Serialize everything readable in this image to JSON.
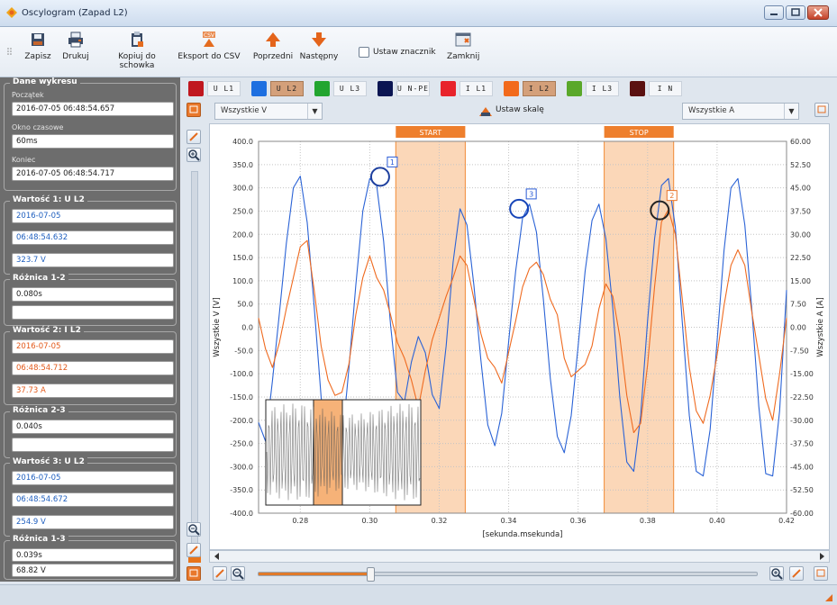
{
  "window": {
    "title": "Oscylogram (Zapad L2)"
  },
  "toolbar": {
    "save": "Zapisz",
    "print": "Drukuj",
    "copy": "Kopiuj do schowka",
    "export_csv": "Eksport do CSV",
    "previous": "Poprzedni",
    "next": "Następny",
    "set_marker": "Ustaw znacznik",
    "set_marker_checked": false,
    "close": "Zamknij",
    "csv_badge": "CSV"
  },
  "panel": {
    "chart_data_group": {
      "title": "Dane wykresu",
      "start_label": "Początek",
      "start_value": "2016-07-05 06:48:54.657",
      "window_label": "Okno czasowe",
      "window_value": "60ms",
      "end_label": "Koniec",
      "end_value": "2016-07-05 06:48:54.717"
    },
    "value1": {
      "title": "Wartość 1: U L2",
      "date": "2016-07-05",
      "time": "06:48:54.632",
      "value": "323.7 V"
    },
    "diff12": {
      "title": "Różnica 1-2",
      "value": "0.080s",
      "value2": ""
    },
    "value2": {
      "title": "Wartość 2: I L2",
      "date": "2016-07-05",
      "time": "06:48:54.712",
      "value": "37.73 A"
    },
    "diff23": {
      "title": "Różnica 2-3",
      "value": "0.040s",
      "value2": ""
    },
    "value3": {
      "title": "Wartość 3: U L2",
      "date": "2016-07-05",
      "time": "06:48:54.672",
      "value": "254.9 V"
    },
    "diff13": {
      "title": "Różnica 1-3",
      "value": "0.039s",
      "value2": "68.82 V"
    }
  },
  "channels": [
    {
      "name": "U L1",
      "color": "#c0171f",
      "selected": false
    },
    {
      "name": "U L2",
      "color": "#1d6fe0",
      "selected": true
    },
    {
      "name": "U L3",
      "color": "#22a52f",
      "selected": false
    },
    {
      "name": "U N-PE",
      "color": "#0b1552",
      "selected": false
    },
    {
      "name": "I L1",
      "color": "#e8232b",
      "selected": false
    },
    {
      "name": "I L2",
      "color": "#f26a1c",
      "selected": true
    },
    {
      "name": "I L3",
      "color": "#5aa82a",
      "selected": false
    },
    {
      "name": "I N",
      "color": "#5b1111",
      "selected": false
    }
  ],
  "selectors": {
    "left": "Wszystkie V",
    "right": "Wszystkie A",
    "set_scale": "Ustaw skalę"
  },
  "chart_data": {
    "type": "line",
    "xlabel": "[sekunda.msekunda]",
    "ylabel_left": "Wszystkie V [V]",
    "ylabel_right": "Wszystkie A [A]",
    "xlim": [
      0.268,
      0.42
    ],
    "ylim_left": [
      -400,
      400
    ],
    "ylim_right": [
      -60,
      60
    ],
    "x_ticks": [
      "0.28",
      "0.30",
      "0.32",
      "0.34",
      "0.36",
      "0.38",
      "0.40",
      "0.42"
    ],
    "y_ticks_left": [
      "400.0",
      "350.0",
      "300.0",
      "250.0",
      "200.0",
      "150.0",
      "100.0",
      "50.0",
      "0.0",
      "-50.0",
      "-100.0",
      "-150.0",
      "-200.0",
      "-250.0",
      "-300.0",
      "-350.0",
      "-400.0"
    ],
    "y_ticks_right": [
      "60.00",
      "52.50",
      "45.00",
      "37.50",
      "30.00",
      "22.50",
      "15.00",
      "7.50",
      "0.00",
      "-7.50",
      "-15.00",
      "-22.50",
      "-30.00",
      "-37.50",
      "-45.00",
      "-52.50",
      "-60.00"
    ],
    "grid": true,
    "regions": [
      {
        "label": "START",
        "x0": 0.3075,
        "x1": 0.3275
      },
      {
        "label": "STOP",
        "x0": 0.3675,
        "x1": 0.3875
      }
    ],
    "markers": [
      {
        "label": "1",
        "x": 0.303,
        "y": 323.7,
        "axis": "left",
        "color": "#1d3f9e"
      },
      {
        "label": "3",
        "x": 0.343,
        "y": 254.9,
        "axis": "left",
        "color": "#1745b8"
      },
      {
        "label": "2",
        "x": 0.3835,
        "y": 37.73,
        "axis": "right",
        "color": "#222222"
      }
    ],
    "series": [
      {
        "channel": "U L2",
        "axis": "left",
        "color": "#2b63d6",
        "x": [
          0.268,
          0.27,
          0.272,
          0.274,
          0.276,
          0.278,
          0.28,
          0.282,
          0.284,
          0.286,
          0.288,
          0.29,
          0.292,
          0.294,
          0.296,
          0.298,
          0.3,
          0.302,
          0.304,
          0.306,
          0.308,
          0.31,
          0.312,
          0.314,
          0.316,
          0.318,
          0.32,
          0.322,
          0.324,
          0.326,
          0.328,
          0.33,
          0.332,
          0.334,
          0.336,
          0.338,
          0.34,
          0.342,
          0.344,
          0.346,
          0.348,
          0.35,
          0.352,
          0.354,
          0.356,
          0.358,
          0.36,
          0.362,
          0.364,
          0.366,
          0.368,
          0.37,
          0.372,
          0.374,
          0.376,
          0.378,
          0.38,
          0.382,
          0.384,
          0.386,
          0.388,
          0.39,
          0.392,
          0.394,
          0.396,
          0.398,
          0.4,
          0.402,
          0.404,
          0.406,
          0.408,
          0.41,
          0.412,
          0.414,
          0.416,
          0.418,
          0.42
        ],
        "y": [
          -205,
          -245,
          -115,
          30,
          180,
          300,
          325,
          225,
          45,
          -150,
          -295,
          -330,
          -250,
          -90,
          90,
          250,
          320,
          305,
          185,
          5,
          -140,
          -160,
          -75,
          -20,
          -55,
          -145,
          -175,
          -40,
          140,
          255,
          220,
          90,
          -70,
          -210,
          -255,
          -185,
          -30,
          120,
          235,
          265,
          205,
          60,
          -110,
          -235,
          -270,
          -190,
          -40,
          120,
          230,
          265,
          190,
          40,
          -150,
          -290,
          -310,
          -190,
          15,
          190,
          305,
          320,
          215,
          10,
          -190,
          -310,
          -320,
          -220,
          -30,
          165,
          300,
          320,
          220,
          40,
          -170,
          -315,
          -320,
          -180,
          80
        ]
      },
      {
        "channel": "I L2",
        "axis": "right",
        "color": "#ef6a1f",
        "x": [
          0.268,
          0.27,
          0.272,
          0.274,
          0.276,
          0.278,
          0.28,
          0.282,
          0.284,
          0.286,
          0.288,
          0.29,
          0.292,
          0.294,
          0.296,
          0.298,
          0.3,
          0.302,
          0.304,
          0.306,
          0.308,
          0.31,
          0.312,
          0.314,
          0.316,
          0.318,
          0.32,
          0.322,
          0.324,
          0.326,
          0.328,
          0.33,
          0.332,
          0.334,
          0.336,
          0.338,
          0.34,
          0.342,
          0.344,
          0.346,
          0.348,
          0.35,
          0.352,
          0.354,
          0.356,
          0.358,
          0.36,
          0.362,
          0.364,
          0.366,
          0.368,
          0.37,
          0.372,
          0.374,
          0.376,
          0.378,
          0.38,
          0.382,
          0.384,
          0.386,
          0.388,
          0.39,
          0.392,
          0.394,
          0.396,
          0.398,
          0.4,
          0.402,
          0.404,
          0.406,
          0.408,
          0.41,
          0.412,
          0.414,
          0.416,
          0.418,
          0.42
        ],
        "y": [
          3,
          -7,
          -13,
          -5,
          6,
          16,
          26,
          28,
          12,
          -6,
          -17,
          -22,
          -21,
          -12,
          4,
          16,
          23,
          16,
          12,
          4,
          -5,
          -10,
          -17,
          -26,
          -14,
          -4,
          3,
          10,
          16,
          23,
          20,
          9,
          -2,
          -10,
          -13,
          -18,
          -8,
          2,
          13,
          19,
          21,
          17,
          9,
          4,
          -10,
          -16,
          -14,
          -12,
          -6,
          6,
          14,
          10,
          -3,
          -22,
          -34,
          -31,
          -12,
          13,
          34,
          38,
          30,
          9,
          -13,
          -27,
          -31,
          -22,
          -9,
          7,
          20,
          25,
          20,
          5,
          -9,
          -23,
          -30,
          -15,
          3
        ]
      }
    ]
  }
}
